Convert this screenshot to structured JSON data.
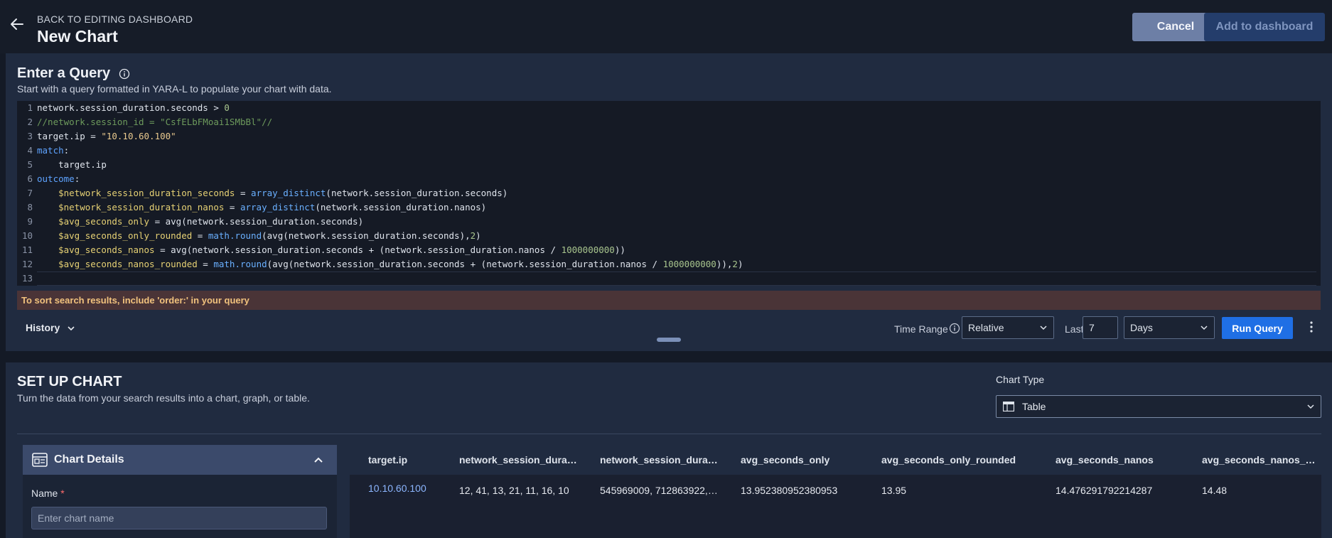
{
  "header": {
    "back_label": "BACK TO EDITING DASHBOARD",
    "title": "New Chart",
    "cancel_label": "Cancel",
    "add_label": "Add to dashboard"
  },
  "query": {
    "title": "Enter a Query",
    "subtitle": "Start with a query formatted in YARA-L to populate your chart with data.",
    "lines": [
      "network.session_duration.seconds > 0",
      "//network.session_id = \"CsfELbFMoai1SMbBl\"//",
      "target.ip = \"10.10.60.100\"",
      "match:",
      "    target.ip",
      "outcome:",
      "    $network_session_duration_seconds = array_distinct(network.session_duration.seconds)",
      "    $network_session_duration_nanos = array_distinct(network.session_duration.nanos)",
      "    $avg_seconds_only = avg(network.session_duration.seconds)",
      "    $avg_seconds_only_rounded = math.round(avg(network.session_duration.seconds),2)",
      "    $avg_seconds_nanos = avg(network.session_duration.seconds + (network.session_duration.nanos / 1000000000))",
      "    $avg_seconds_nanos_rounded = math.round(avg(network.session_duration.seconds + (network.session_duration.nanos / 1000000000)),2)",
      ""
    ],
    "warning": "To sort search results, include 'order:' in your query",
    "history_label": "History",
    "time_range_label": "Time Range",
    "time_range_value": "Relative",
    "last_label": "Last",
    "last_value": "7",
    "unit_value": "Days",
    "run_label": "Run Query"
  },
  "chart_setup": {
    "title": "SET UP CHART",
    "subtitle": "Turn the data from your search results into a chart, graph, or table.",
    "chart_type_label": "Chart Type",
    "chart_type_value": "Table",
    "details_title": "Chart Details",
    "name_label": "Name",
    "name_required": "*",
    "name_placeholder": "Enter chart name"
  },
  "results": {
    "columns": [
      "target.ip",
      "network_session_durati...",
      "network_session_durati...",
      "avg_seconds_only",
      "avg_seconds_only_rounded",
      "avg_seconds_nanos",
      "avg_seconds_nanos_rou..."
    ],
    "rows": [
      [
        "10.10.60.100",
        "12, 41, 13, 21, 11, 16, 10",
        "545969009, 712863922, ...",
        "13.952380952380953",
        "13.95",
        "14.476291792214287",
        "14.48"
      ]
    ]
  },
  "colors": {
    "accent": "#1f6fe5",
    "warning_bg": "#4a3437",
    "warning_text": "#f1c27d",
    "link": "#8cb6ff"
  }
}
